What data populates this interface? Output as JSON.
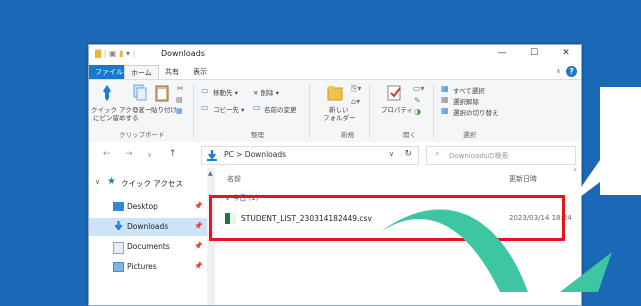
{
  "window": {
    "title": "Downloads",
    "minimize_label": "—",
    "maximize_label": "☐",
    "close_label": "✕"
  },
  "ribbon_tabs": [
    "ファイル",
    "ホーム",
    "共有",
    "表示"
  ],
  "ribbon": {
    "clipboard": {
      "pin_label_1": "クイック アクセス",
      "pin_label_2": "にピン留めする",
      "copy_label": "コピー",
      "paste_label": "貼り付け",
      "group_label": "クリップボード"
    },
    "organize": {
      "move_to": "移動先 ▾",
      "delete": "✕ 削除 ▾",
      "copy_to": "コピー先 ▾",
      "rename": "名前の変更",
      "group_label": "整理"
    },
    "new": {
      "new_folder_1": "新しい",
      "new_folder_2": "フォルダー",
      "group_label": "新規"
    },
    "open": {
      "properties": "プロパティ",
      "group_label": "開く"
    },
    "select": {
      "select_all": "すべて選択",
      "select_none": "選択解除",
      "invert": "選択の切り替え",
      "group_label": "選択"
    }
  },
  "address": {
    "path": "PC  >  Downloads",
    "search_placeholder": "Downloadsの検索"
  },
  "nav_pane": {
    "quick_access": "クイック アクセス",
    "items": [
      "Desktop",
      "Downloads",
      "Documents",
      "Pictures"
    ]
  },
  "content": {
    "col_name": "名前",
    "col_date": "更新日時",
    "group_today": "∨  今日 (1)",
    "files": [
      {
        "name": "STUDENT_LIST_230314182449.csv",
        "date": "2023/03/14 18:24"
      }
    ]
  },
  "colors": {
    "background": "#1a68b6",
    "highlight": "#e5131b",
    "arrow": "#3ec6a3",
    "accent": "#1979ca"
  }
}
